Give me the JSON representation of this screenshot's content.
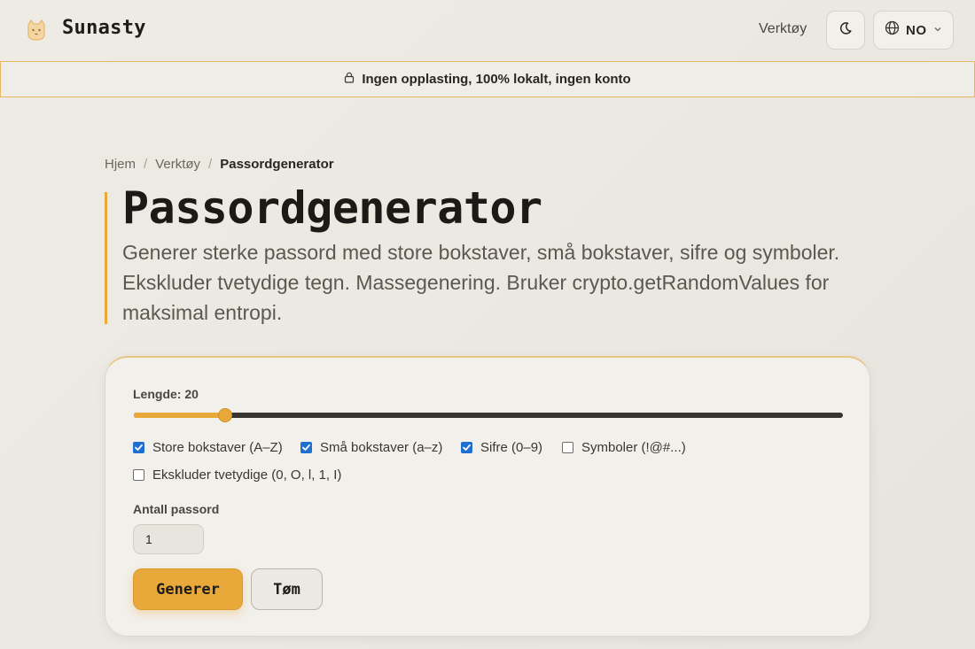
{
  "header": {
    "brand": "Sunasty",
    "nav_tools": "Verktøy",
    "lang": "NO",
    "theme_icon": "moon-icon",
    "lang_icon": "globe-icon"
  },
  "banner": {
    "text": "Ingen opplasting, 100% lokalt, ingen konto",
    "icon": "lock-icon"
  },
  "breadcrumb": {
    "items": [
      "Hjem",
      "Verktøy",
      "Passordgenerator"
    ],
    "separator": "/"
  },
  "page": {
    "title": "Passordgenerator",
    "description": "Generer sterke passord med store bokstaver, små bokstaver, sifre og symboler. Ekskluder tvetydige tegn. Massegenering. Bruker crypto.getRandomValues for maksimal entropi."
  },
  "form": {
    "length_label": "Lengde: 20",
    "length_value": 20,
    "length_min": 4,
    "length_max": 128,
    "options": [
      {
        "label": "Store bokstaver (A–Z)",
        "checked": true
      },
      {
        "label": "Små bokstaver (a–z)",
        "checked": true
      },
      {
        "label": "Sifre (0–9)",
        "checked": true
      },
      {
        "label": "Symboler (!@#...)",
        "checked": false
      },
      {
        "label": "Ekskluder tvetydige (0, O, l, 1, I)",
        "checked": false
      }
    ],
    "count_label": "Antall passord",
    "count_value": "1",
    "generate_label": "Generer",
    "clear_label": "Tøm"
  },
  "colors": {
    "accent": "#e9a83a",
    "checkbox": "#1f6fd1",
    "background": "#ebe8e1"
  }
}
